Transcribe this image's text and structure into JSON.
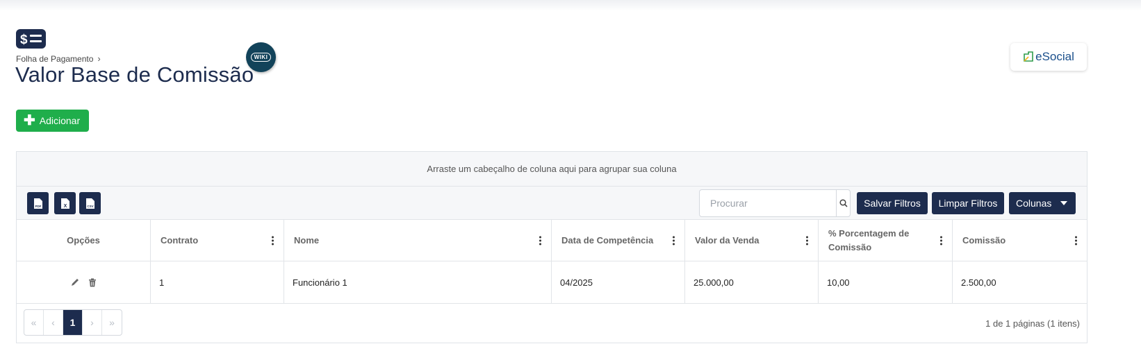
{
  "breadcrumb": {
    "parent": "Folha de Pagamento",
    "separator": "›"
  },
  "page": {
    "title": "Valor Base de Comissão"
  },
  "wiki": {
    "label": "WIKI"
  },
  "esocial": {
    "label": "eSocial"
  },
  "actions": {
    "add_label": "Adicionar"
  },
  "grid": {
    "group_hint": "Arraste um cabeçalho de coluna aqui para agrupar sua coluna",
    "toolbar": {
      "exports": [
        {
          "label": "PDF",
          "icon": "pdf-file-icon"
        },
        {
          "label": "X",
          "icon": "excel-file-icon"
        },
        {
          "label": "CSV",
          "icon": "csv-file-icon"
        }
      ],
      "search_placeholder": "Procurar",
      "save_filters": "Salvar Filtros",
      "clear_filters": "Limpar Filtros",
      "columns": "Colunas"
    },
    "columns": [
      "Opções",
      "Contrato",
      "Nome",
      "Data de Competência",
      "Valor da Venda",
      "% Porcentagem de Comissão",
      "Comissão"
    ],
    "rows": [
      {
        "contrato": "1",
        "nome": "Funcionário 1",
        "data_competencia": "04/2025",
        "valor_venda": "25.000,00",
        "porcentagem": "10,00",
        "comissao": "2.500,00"
      }
    ],
    "pagination": {
      "first": "«",
      "prev": "‹",
      "current": "1",
      "next": "›",
      "last": "»",
      "info": "1 de 1 páginas (1 itens)"
    }
  },
  "colors": {
    "primary": "#1d2c4e",
    "success": "#1fae4b",
    "wiki": "#12435a",
    "esocial_blue": "#1a4f8b"
  }
}
